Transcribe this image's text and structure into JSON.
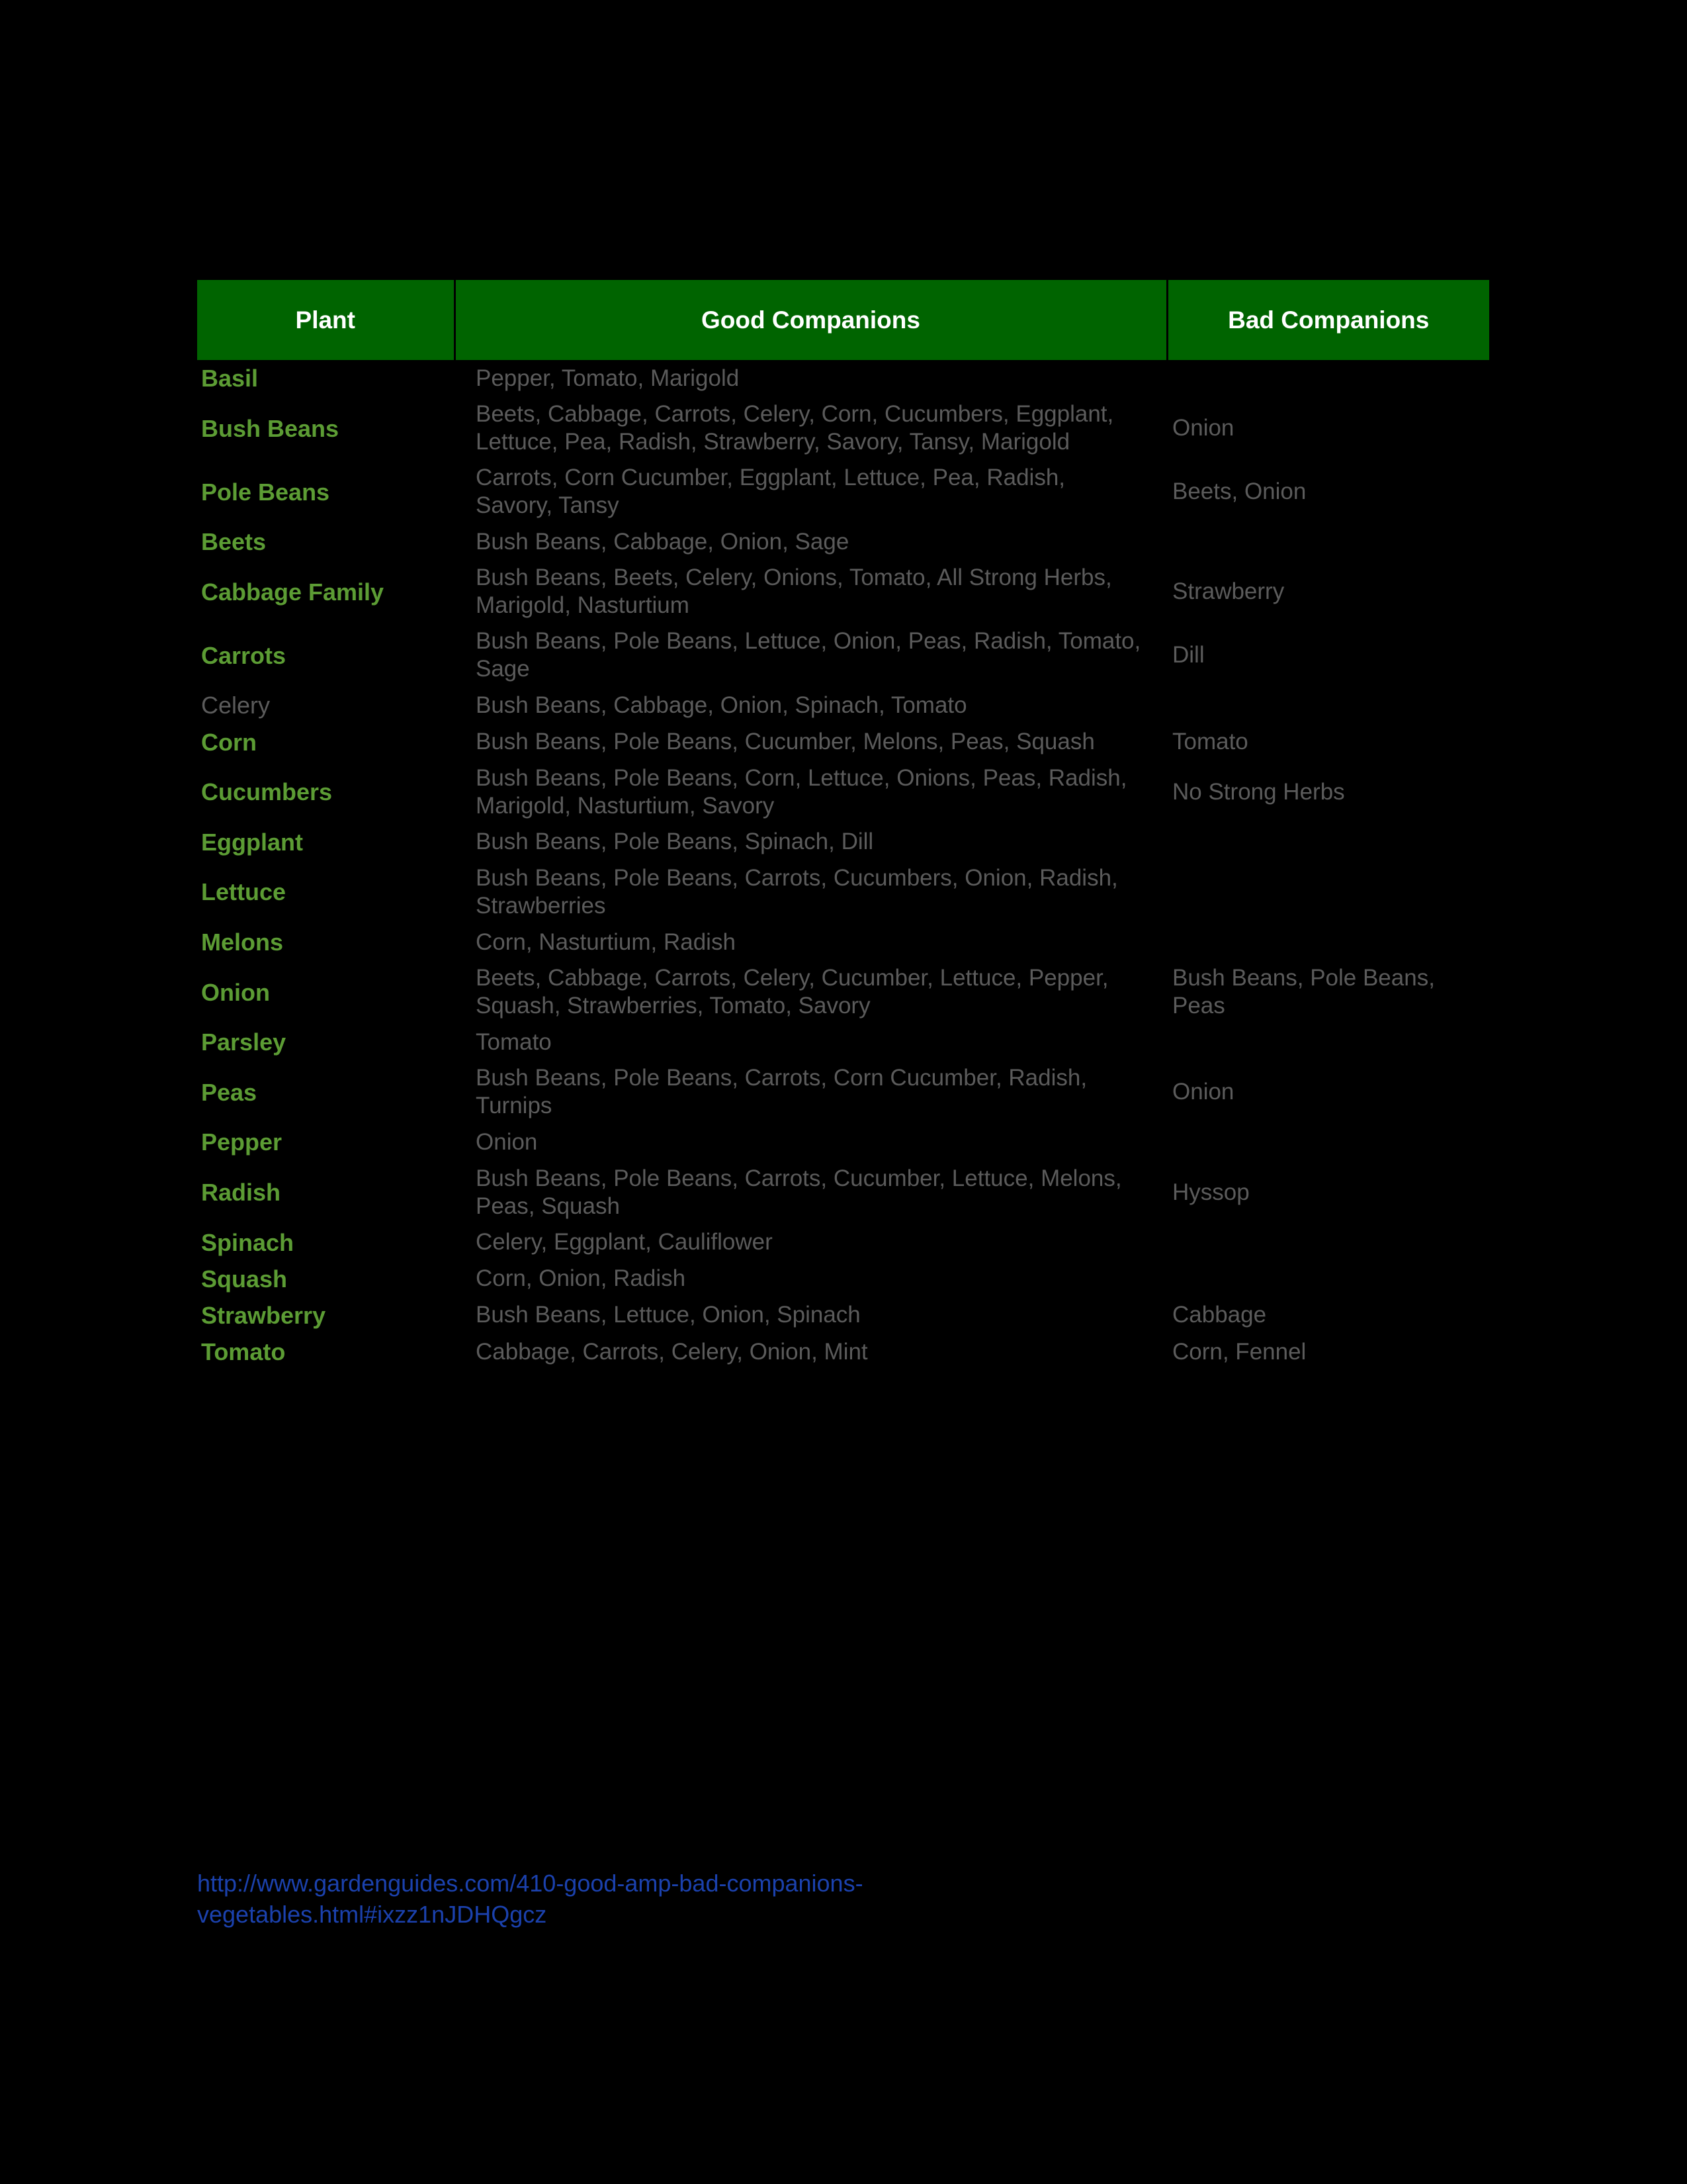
{
  "table": {
    "columns": [
      "Plant",
      "Good Companions",
      "Bad Companions"
    ],
    "rows": [
      {
        "plant": "Basil",
        "plant_muted": false,
        "good": "Pepper, Tomato, Marigold",
        "bad": ""
      },
      {
        "plant": "Bush Beans",
        "plant_muted": false,
        "good": "Beets, Cabbage, Carrots, Celery, Corn, Cucumbers, Eggplant, Lettuce, Pea, Radish, Strawberry, Savory, Tansy, Marigold",
        "bad": "Onion"
      },
      {
        "plant": "Pole Beans",
        "plant_muted": false,
        "good": "Carrots, Corn Cucumber, Eggplant, Lettuce, Pea, Radish, Savory, Tansy",
        "bad": "Beets, Onion"
      },
      {
        "plant": "Beets",
        "plant_muted": false,
        "good": "Bush Beans, Cabbage, Onion, Sage",
        "bad": ""
      },
      {
        "plant": "Cabbage Family",
        "plant_muted": false,
        "good": "Bush Beans, Beets, Celery, Onions, Tomato, All Strong Herbs, Marigold, Nasturtium",
        "bad": "Strawberry"
      },
      {
        "plant": "Carrots",
        "plant_muted": false,
        "good": "Bush Beans, Pole Beans, Lettuce, Onion, Peas, Radish, Tomato, Sage",
        "bad": "Dill"
      },
      {
        "plant": "Celery",
        "plant_muted": true,
        "good": "Bush Beans, Cabbage, Onion, Spinach, Tomato",
        "bad": ""
      },
      {
        "plant": "Corn",
        "plant_muted": false,
        "good": "Bush Beans, Pole Beans, Cucumber, Melons, Peas, Squash",
        "bad": "Tomato"
      },
      {
        "plant": "Cucumbers",
        "plant_muted": false,
        "good": "Bush Beans, Pole Beans, Corn, Lettuce, Onions, Peas, Radish, Marigold, Nasturtium, Savory",
        "bad": "No Strong Herbs"
      },
      {
        "plant": "Eggplant",
        "plant_muted": false,
        "good": "Bush Beans, Pole Beans, Spinach, Dill",
        "bad": ""
      },
      {
        "plant": "Lettuce",
        "plant_muted": false,
        "good": "Bush Beans, Pole Beans, Carrots, Cucumbers, Onion, Radish, Strawberries",
        "bad": ""
      },
      {
        "plant": "Melons",
        "plant_muted": false,
        "good": "Corn, Nasturtium, Radish",
        "bad": ""
      },
      {
        "plant": "Onion",
        "plant_muted": false,
        "good": "Beets, Cabbage, Carrots, Celery, Cucumber, Lettuce, Pepper, Squash, Strawberries, Tomato, Savory",
        "bad": "Bush Beans, Pole Beans, Peas"
      },
      {
        "plant": "Parsley",
        "plant_muted": false,
        "good": "Tomato",
        "bad": ""
      },
      {
        "plant": "Peas",
        "plant_muted": false,
        "good": "Bush Beans, Pole Beans, Carrots, Corn Cucumber, Radish, Turnips",
        "bad": "Onion"
      },
      {
        "plant": "Pepper",
        "plant_muted": false,
        "good": "Onion",
        "bad": ""
      },
      {
        "plant": "Radish",
        "plant_muted": false,
        "good": "Bush Beans, Pole Beans, Carrots, Cucumber, Lettuce, Melons, Peas, Squash",
        "bad": "Hyssop"
      },
      {
        "plant": "Spinach",
        "plant_muted": false,
        "good": "Celery, Eggplant, Cauliflower",
        "bad": ""
      },
      {
        "plant": "Squash",
        "plant_muted": false,
        "good": "Corn, Onion, Radish",
        "bad": ""
      },
      {
        "plant": "Strawberry",
        "plant_muted": false,
        "good": "Bush Beans, Lettuce, Onion, Spinach",
        "bad": "Cabbage"
      },
      {
        "plant": "Tomato",
        "plant_muted": false,
        "good": "Cabbage, Carrots, Celery, Onion, Mint",
        "bad": "Corn, Fennel"
      }
    ]
  },
  "source": {
    "url_text": "http://www.gardenguides.com/410-good-amp-bad-companions-vegetables.html#ixzz1nJDHQgcz"
  },
  "colors": {
    "background": "#000000",
    "header_green": "#006400",
    "plant_green": "#5c9c34",
    "body_gray": "#5b5b5b",
    "link_blue": "#1b41ad",
    "header_text": "#ffffff"
  }
}
